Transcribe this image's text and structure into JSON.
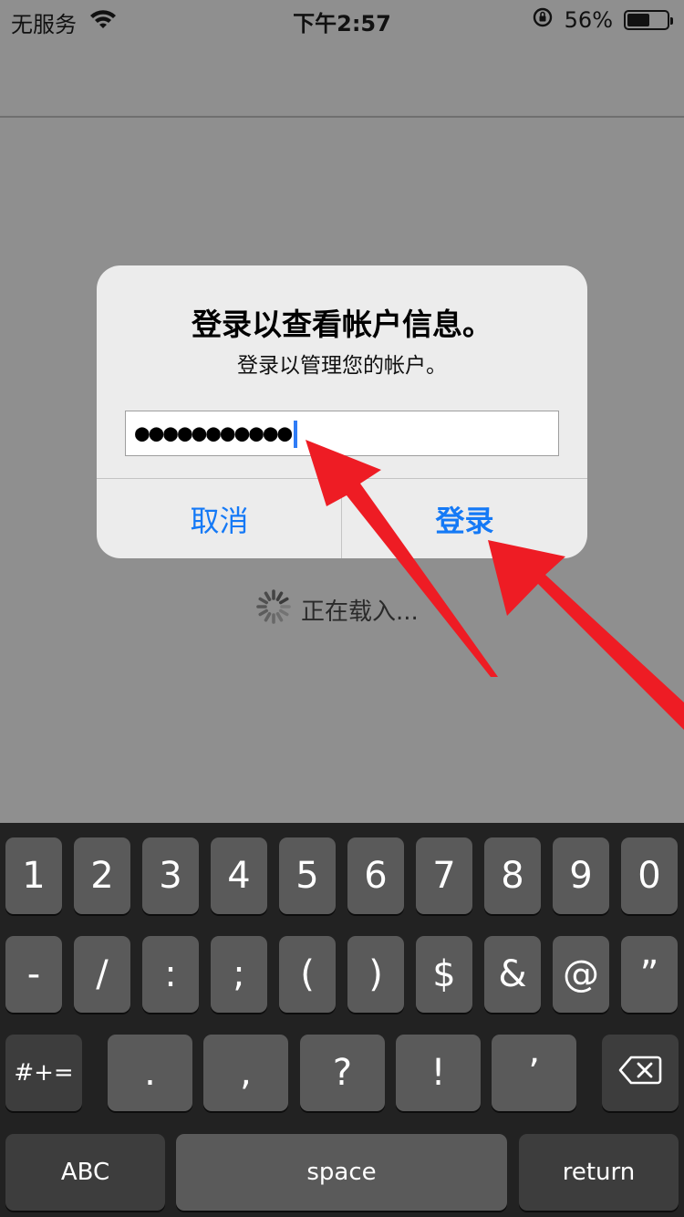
{
  "status": {
    "carrier": "无服务",
    "time": "下午2:57",
    "battery": "56%",
    "battery_level": 0.56
  },
  "alert": {
    "title": "登录以查看帐户信息。",
    "message": "登录以管理您的帐户。",
    "password_value": "●●●●●●●●●●●",
    "cancel_label": "取消",
    "login_label": "登录"
  },
  "loading": {
    "text": "正在载入..."
  },
  "keyboard": {
    "row1": [
      "1",
      "2",
      "3",
      "4",
      "5",
      "6",
      "7",
      "8",
      "9",
      "0"
    ],
    "row2": [
      "-",
      "/",
      ":",
      ";",
      "(",
      ")",
      "$",
      "&",
      "@",
      "”"
    ],
    "row3_mode": "#+=",
    "row3": [
      ".",
      ",",
      "?",
      "!",
      "’"
    ],
    "row4_abc": "ABC",
    "row4_space": "space",
    "row4_return": "return"
  },
  "icons": {
    "wifi": "wifi-icon",
    "rotation_lock": "rotation-lock-icon",
    "battery": "battery-icon",
    "spinner": "spinner-icon",
    "backspace": "backspace-icon"
  },
  "colors": {
    "accent_blue": "#1479f6",
    "arrow_red": "#ee1c24"
  }
}
